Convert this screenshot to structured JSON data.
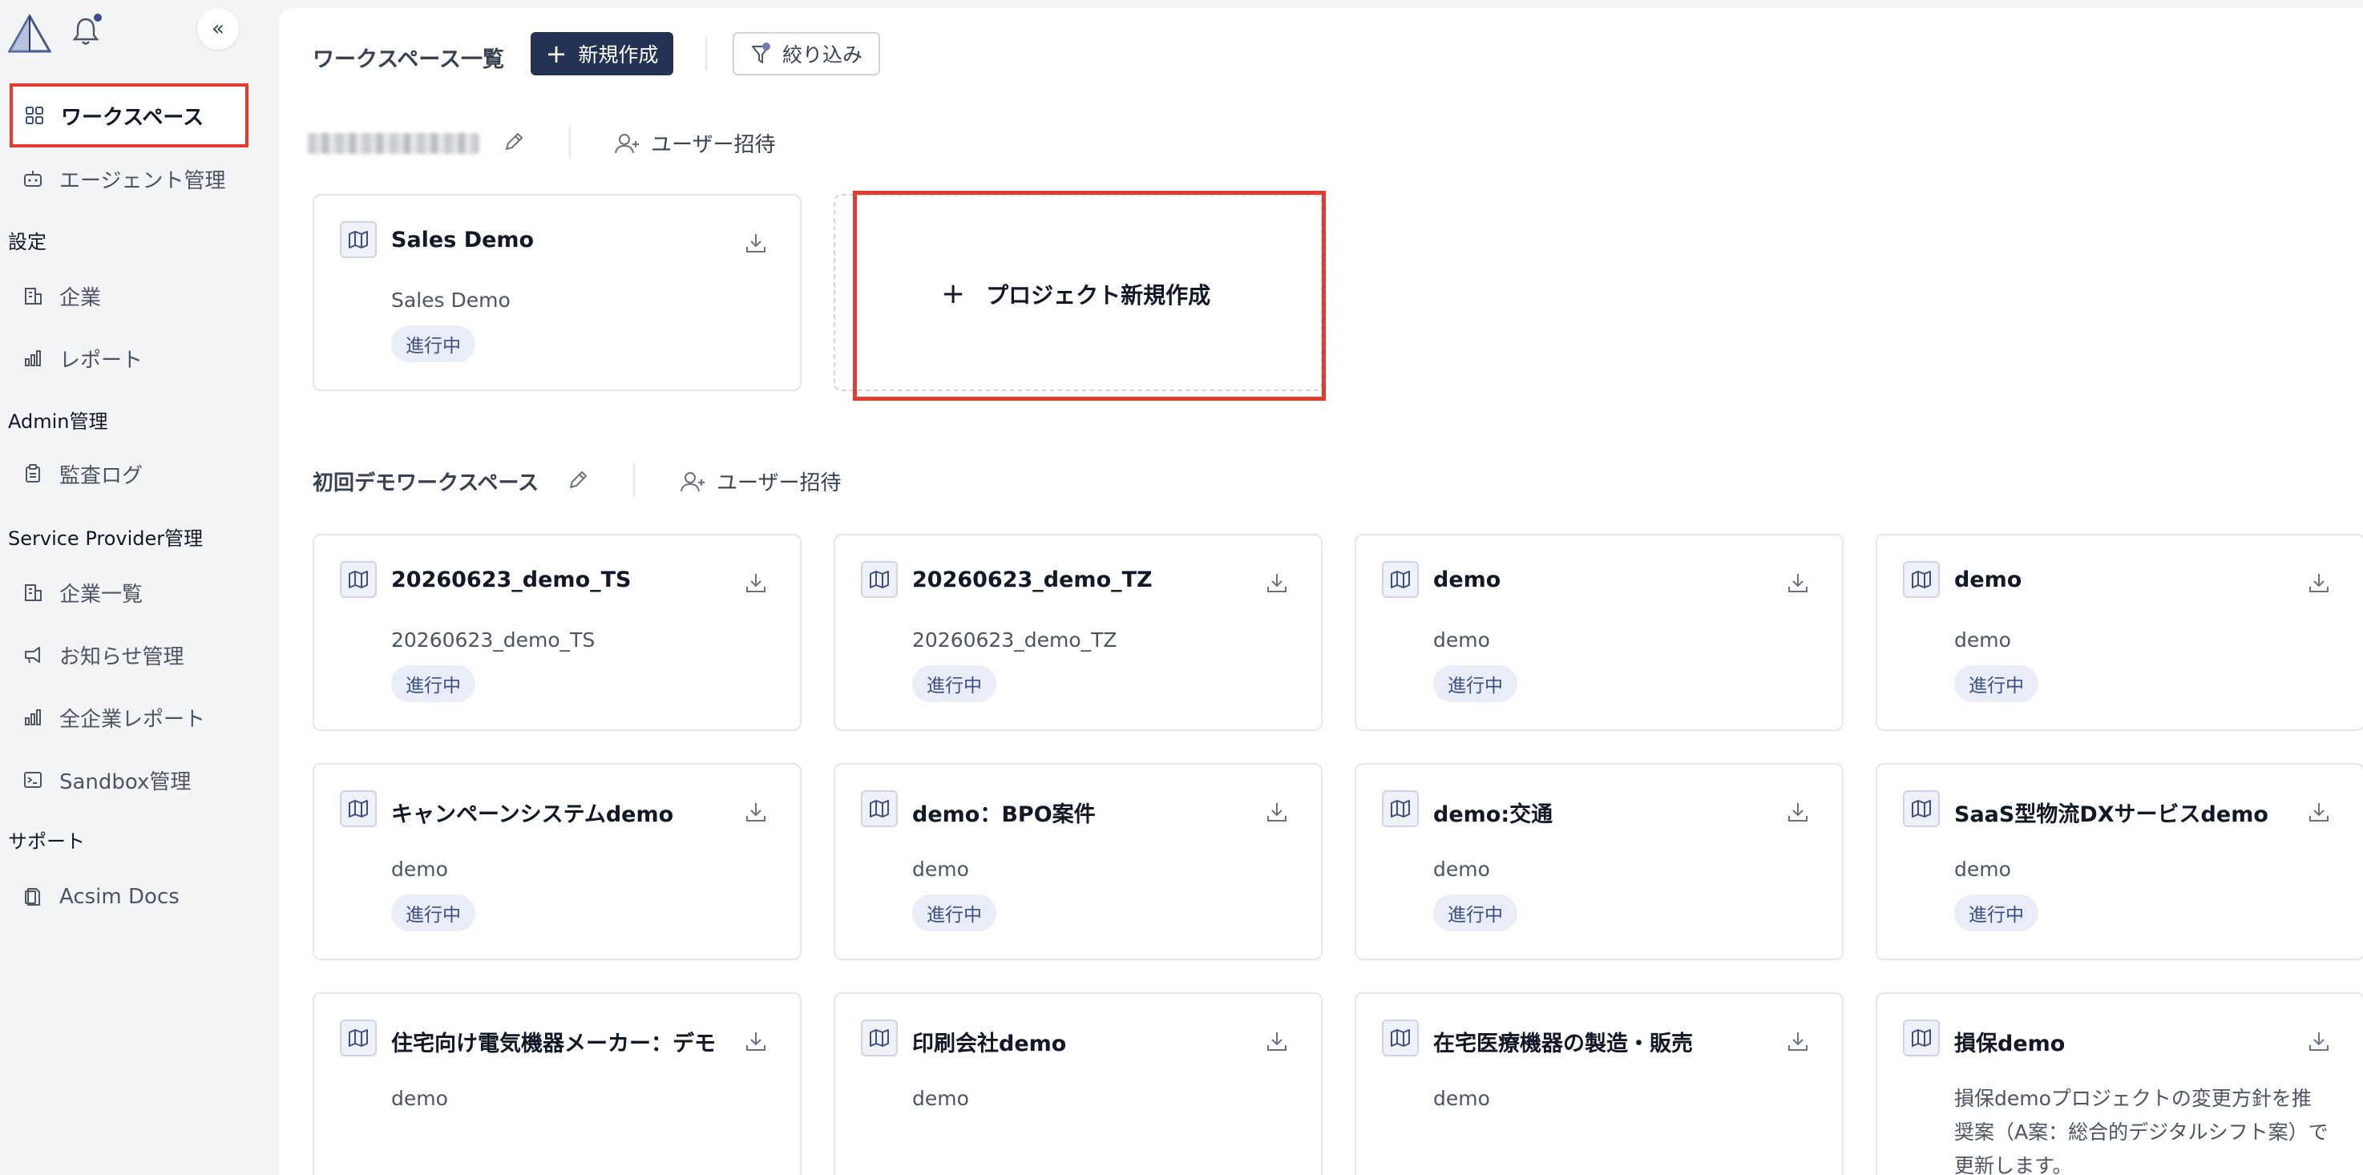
{
  "sidebar": {
    "collapse_label": "«",
    "items": [
      {
        "label": "ワークスペース",
        "icon": "grid-icon",
        "active": true
      },
      {
        "label": "エージェント管理",
        "icon": "robot-icon"
      }
    ],
    "sections": [
      {
        "label": "設定",
        "items": [
          {
            "label": "企業",
            "icon": "building-icon"
          },
          {
            "label": "レポート",
            "icon": "bar-chart-icon"
          }
        ]
      },
      {
        "label": "Admin管理",
        "items": [
          {
            "label": "監査ログ",
            "icon": "clipboard-icon"
          }
        ]
      },
      {
        "label": "Service Provider管理",
        "items": [
          {
            "label": "企業一覧",
            "icon": "building-icon"
          },
          {
            "label": "お知らせ管理",
            "icon": "megaphone-icon"
          },
          {
            "label": "全企業レポート",
            "icon": "bar-chart-icon"
          },
          {
            "label": "Sandbox管理",
            "icon": "terminal-icon"
          }
        ]
      },
      {
        "label": "サポート",
        "items": [
          {
            "label": "Acsim Docs",
            "icon": "document-icon"
          }
        ]
      }
    ]
  },
  "toolbar": {
    "title": "ワークスペース一覧",
    "new_label": "新規作成",
    "filter_label": "絞り込み"
  },
  "workspaces": [
    {
      "name": "",
      "invite_label": "ユーザー招待",
      "new_project_label": "プロジェクト新規作成",
      "projects": [
        {
          "title": "Sales Demo",
          "desc": "Sales Demo",
          "status": "進行中"
        }
      ]
    },
    {
      "name": "初回デモワークスペース",
      "invite_label": "ユーザー招待",
      "projects": [
        {
          "title": "20260623_demo_TS",
          "desc": "20260623_demo_TS",
          "status": "進行中"
        },
        {
          "title": "20260623_demo_TZ",
          "desc": "20260623_demo_TZ",
          "status": "進行中"
        },
        {
          "title": "demo",
          "desc": "demo",
          "status": "進行中"
        },
        {
          "title": "demo",
          "desc": "demo",
          "status": "進行中"
        },
        {
          "title": "キャンペーンシステムdemo",
          "desc": "demo",
          "status": "進行中"
        },
        {
          "title": "demo：BPO案件",
          "desc": "demo",
          "status": "進行中"
        },
        {
          "title": "demo:交通",
          "desc": "demo",
          "status": "進行中"
        },
        {
          "title": "SaaS型物流DXサービスdemo",
          "desc": "demo",
          "status": "進行中"
        },
        {
          "title": "住宅向け電気機器メーカー：デモ",
          "desc": "demo",
          "status": ""
        },
        {
          "title": "印刷会社demo",
          "desc": "demo",
          "status": ""
        },
        {
          "title": "在宅医療機器の製造・販売",
          "desc": "demo",
          "status": ""
        },
        {
          "title": "損保demo",
          "desc": "損保demoプロジェクトの変更方針を推奨案（A案：総合的デジタルシフト案）で更新します。",
          "status": ""
        }
      ]
    }
  ],
  "colors": {
    "accent": "#243253",
    "highlight": "#e33b2e",
    "status_bg": "#e8edf8",
    "status_text": "#3d4f86"
  }
}
